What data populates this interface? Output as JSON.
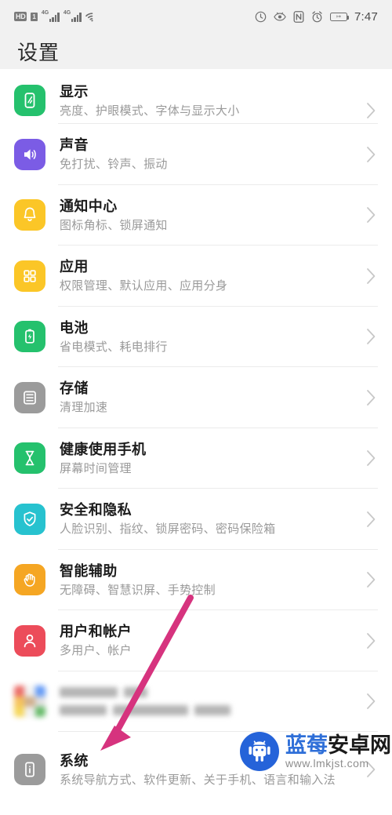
{
  "status_bar": {
    "hd_label": "HD",
    "sim_label": "1",
    "network_label_1": "4G",
    "network_label_2": "4G",
    "icons": [
      "hd-badge",
      "sim-badge",
      "signal-bars-1",
      "signal-bars-2",
      "wifi-icon",
      "data-saver-icon",
      "eye-comfort-icon",
      "nfc-icon",
      "alarm-icon",
      "battery-icon"
    ],
    "battery_level_glyph": "↦",
    "time": "7:47"
  },
  "header": {
    "title": "设置"
  },
  "list": {
    "items": [
      {
        "id": "display",
        "title": "显示",
        "subtitle": "亮度、护眼模式、字体与显示大小",
        "icon": "display-icon",
        "icon_color": "#25c16d"
      },
      {
        "id": "sound",
        "title": "声音",
        "subtitle": "免打扰、铃声、振动",
        "icon": "sound-icon",
        "icon_color": "#7b5ce5"
      },
      {
        "id": "notification-center",
        "title": "通知中心",
        "subtitle": "图标角标、锁屏通知",
        "icon": "bell-icon",
        "icon_color": "#fbc627"
      },
      {
        "id": "apps",
        "title": "应用",
        "subtitle": "权限管理、默认应用、应用分身",
        "icon": "apps-grid-icon",
        "icon_color": "#fbc627"
      },
      {
        "id": "battery",
        "title": "电池",
        "subtitle": "省电模式、耗电排行",
        "icon": "battery-icon",
        "icon_color": "#25c16d"
      },
      {
        "id": "storage",
        "title": "存储",
        "subtitle": "清理加速",
        "icon": "storage-icon",
        "icon_color": "#9b9b9b"
      },
      {
        "id": "digital-balance",
        "title": "健康使用手机",
        "subtitle": "屏幕时间管理",
        "icon": "hourglass-icon",
        "icon_color": "#25c16d"
      },
      {
        "id": "security-privacy",
        "title": "安全和隐私",
        "subtitle": "人脸识别、指纹、锁屏密码、密码保险箱",
        "icon": "shield-check-icon",
        "icon_color": "#27c2cf"
      },
      {
        "id": "smart-assistance",
        "title": "智能辅助",
        "subtitle": "无障碍、智慧识屏、手势控制",
        "icon": "hand-icon",
        "icon_color": "#f5a623"
      },
      {
        "id": "users-accounts",
        "title": "用户和帐户",
        "subtitle": "多用户、帐户",
        "icon": "person-icon",
        "icon_color": "#ec4c5a"
      },
      {
        "id": "blurred-item",
        "title": "",
        "subtitle": "",
        "icon": "google-multicolor-icon",
        "icon_color": "#cccccc",
        "blurred": true
      },
      {
        "id": "system",
        "title": "系统",
        "subtitle": "系统导航方式、软件更新、关于手机、语言和输入法",
        "icon": "system-info-icon",
        "icon_color": "#9b9b9b"
      }
    ],
    "chevron_glyph": "›"
  },
  "annotation": {
    "arrow_color": "#d6337e",
    "points_to": "system"
  },
  "watermark": {
    "site_name_blue": "蓝莓",
    "site_name_dark": "安卓网",
    "url": "www.lmkjst.com",
    "logo": "android-robot-icon",
    "logo_color": "#2563d9"
  }
}
